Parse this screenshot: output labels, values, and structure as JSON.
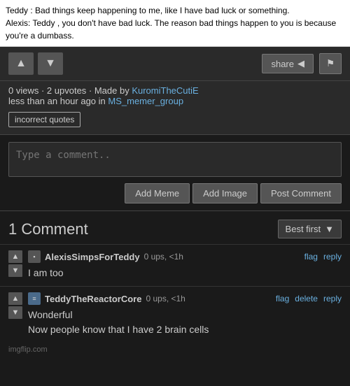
{
  "quote": {
    "line1": "Teddy : Bad things keep happening to me, like I have bad luck or something.",
    "line2": "Alexis: Teddy , you don't have bad luck. The reason bad things happen to you is because you're a dumbass."
  },
  "actions": {
    "upvote_label": "▲",
    "downvote_label": "▼",
    "share_label": "share",
    "share_icon": "◄",
    "flag_label": "⚑"
  },
  "meta": {
    "views": "0 views",
    "separator": " · ",
    "upvotes": "2 upvotes",
    "made_by_text": " · Made by ",
    "author": "KuromiTheCutiE",
    "time_prefix": "less than an hour ago in ",
    "group": "MS_memer_group",
    "tag": "incorrect quotes"
  },
  "comment_input": {
    "placeholder": "Type a comment..",
    "add_meme_label": "Add Meme",
    "add_image_label": "Add Image",
    "post_comment_label": "Post Comment"
  },
  "comments_section": {
    "title": "1 Comment",
    "sort_label": "Best first",
    "sort_arrow": "▼"
  },
  "comments": [
    {
      "username": "AlexisSimpsForTeddy",
      "ups": "0 ups, <1h",
      "text": "I am too",
      "links": [
        "flag",
        "reply"
      ],
      "avatar_type": "normal"
    },
    {
      "username": "TeddyTheReactorCore",
      "ups": "0 ups, <1h",
      "text": "Wonderful\nNow people know that I have 2 brain cells",
      "links": [
        "flag",
        "delete",
        "reply"
      ],
      "avatar_type": "teddy"
    }
  ],
  "footer": {
    "site": "imgflip.com"
  }
}
